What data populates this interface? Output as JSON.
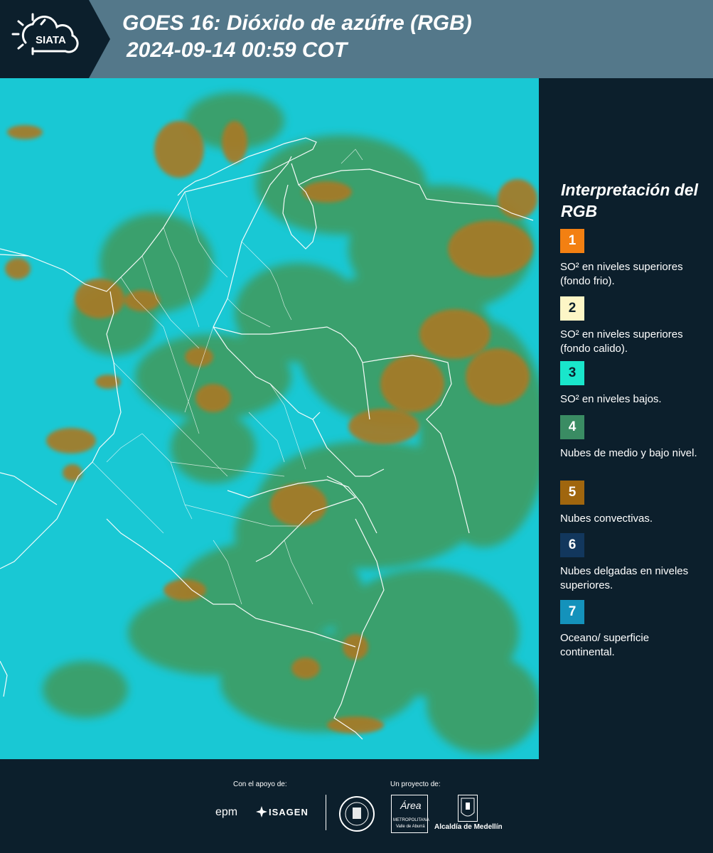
{
  "header": {
    "logo_text": "SIATA",
    "title_line1": "GOES 16: Dióxido de azúfre (RGB)",
    "title_line2": "2024-09-14 00:59 COT"
  },
  "legend": {
    "title": "Interpretación del RGB",
    "items": [
      {
        "num": "1",
        "color": "#f38012",
        "label": "SO² en niveles superiores (fondo frio)."
      },
      {
        "num": "2",
        "color": "#fdf6c6",
        "label": "SO² en niveles superiores (fondo calido)."
      },
      {
        "num": "3",
        "color": "#19e6cb",
        "label": "SO² en niveles bajos."
      },
      {
        "num": "4",
        "color": "#3a8c63",
        "label": "Nubes de medio y bajo nivel."
      },
      {
        "num": "5",
        "color": "#a0660e",
        "label": "Nubes convectivas."
      },
      {
        "num": "6",
        "color": "#12375d",
        "label": "Nubes delgadas en niveles superiores."
      },
      {
        "num": "7",
        "color": "#1492bb",
        "label": "Oceano/ superficie continental."
      }
    ]
  },
  "footer": {
    "support_label": "Con el apoyo de:",
    "project_label": "Un proyecto de:",
    "sponsor1": "epm",
    "sponsor2": "ISAGEN",
    "partner1_line1": "Área",
    "partner1_line2": "METROPOLITANA",
    "partner1_line3": "Valle de Aburrá",
    "partner2": "Alcaldía de Medellín"
  },
  "colors": {
    "header_bg": "#54788a",
    "panel_bg": "#0c1f2c",
    "map_cyan": "#19c8d4",
    "cloud_green": "#3f9a5c",
    "cloud_brown": "#a77a26",
    "border_white": "#ffffff"
  }
}
